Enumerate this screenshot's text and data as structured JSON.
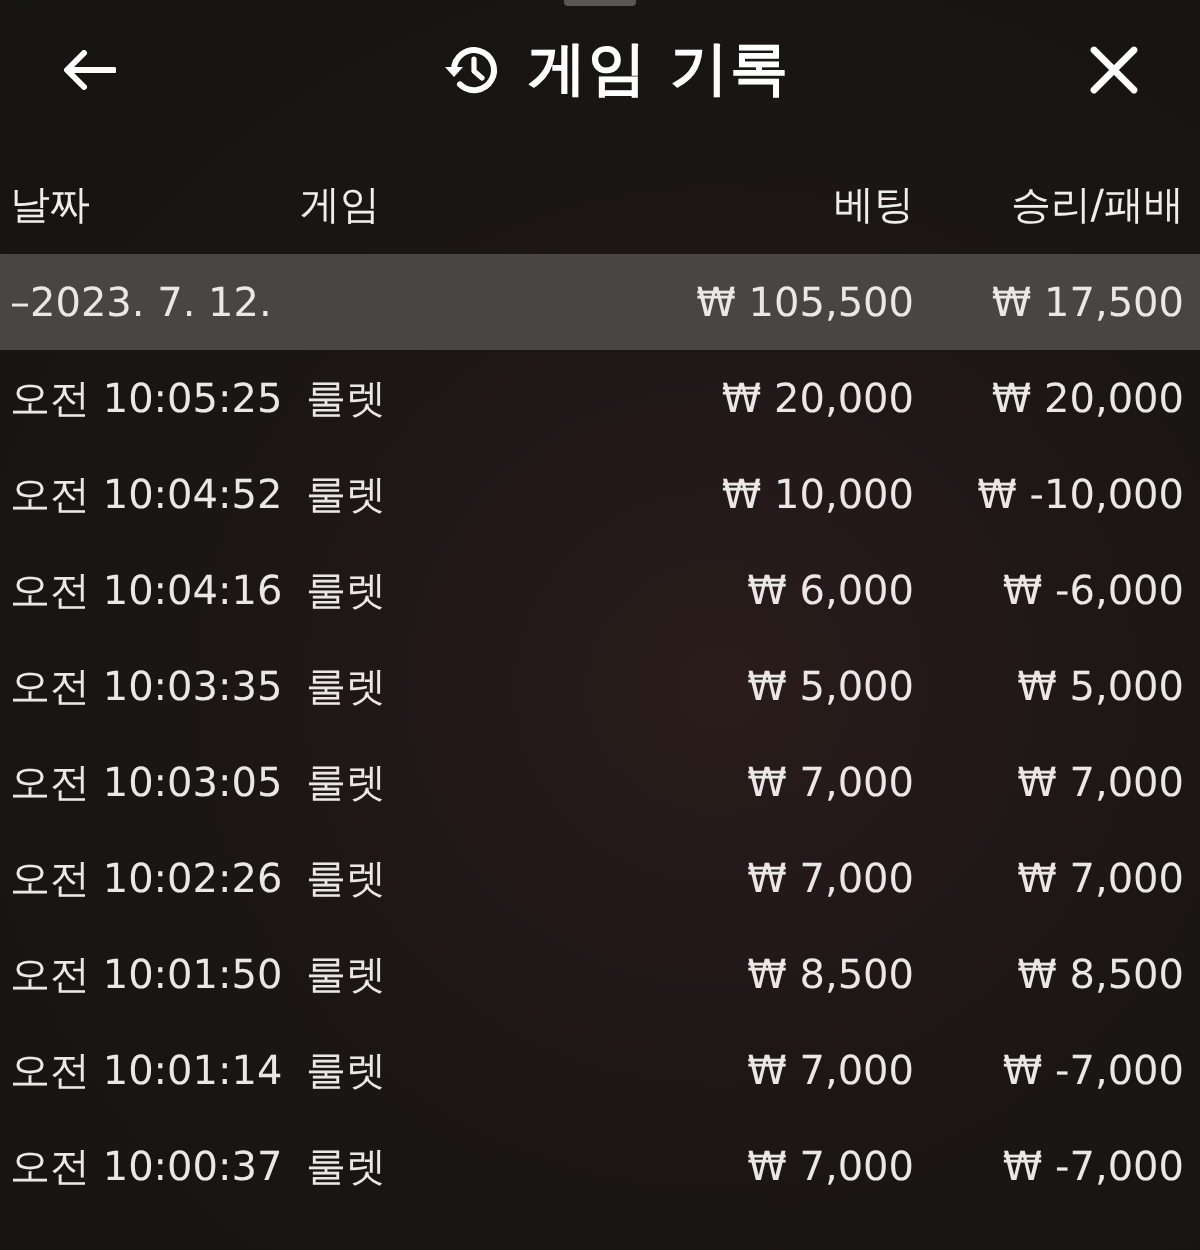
{
  "header": {
    "title": "게임 기록"
  },
  "columns": [
    "날짜",
    "게임",
    "베팅",
    "승리/패배"
  ],
  "summary": {
    "date": "–2023. 7. 12.",
    "bet": "₩ 105,500",
    "result": "₩ 17,500"
  },
  "rows": [
    {
      "time": "오전 10:05:25",
      "game": "룰렛",
      "bet": "₩ 20,000",
      "result": "₩ 20,000"
    },
    {
      "time": "오전 10:04:52",
      "game": "룰렛",
      "bet": "₩ 10,000",
      "result": "₩ -10,000"
    },
    {
      "time": "오전 10:04:16",
      "game": "룰렛",
      "bet": "₩ 6,000",
      "result": "₩ -6,000"
    },
    {
      "time": "오전 10:03:35",
      "game": "룰렛",
      "bet": "₩ 5,000",
      "result": "₩ 5,000"
    },
    {
      "time": "오전 10:03:05",
      "game": "룰렛",
      "bet": "₩ 7,000",
      "result": "₩ 7,000"
    },
    {
      "time": "오전 10:02:26",
      "game": "룰렛",
      "bet": "₩ 7,000",
      "result": "₩ 7,000"
    },
    {
      "time": "오전 10:01:50",
      "game": "룰렛",
      "bet": "₩ 8,500",
      "result": "₩ 8,500"
    },
    {
      "time": "오전 10:01:14",
      "game": "룰렛",
      "bet": "₩ 7,000",
      "result": "₩ -7,000"
    },
    {
      "time": "오전 10:00:37",
      "game": "룰렛",
      "bet": "₩ 7,000",
      "result": "₩ -7,000"
    }
  ]
}
